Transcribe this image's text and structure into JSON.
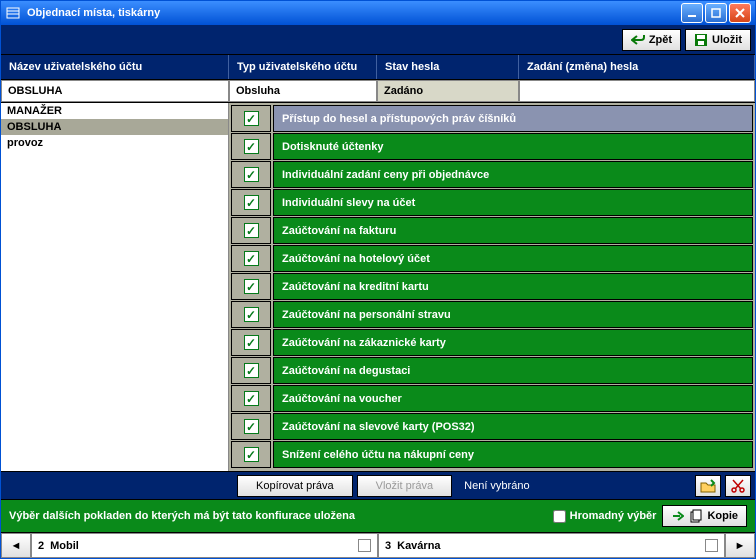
{
  "window": {
    "title": "Objednací místa, tiskárny"
  },
  "toolbar": {
    "back": "Zpět",
    "save": "Uložit"
  },
  "headers": {
    "name": "Název uživatelského účtu",
    "type": "Typ uživatelského účtu",
    "pwstatus": "Stav hesla",
    "pwset": "Zadání (změna) hesla"
  },
  "current": {
    "name": "OBSLUHA",
    "type": "Obsluha",
    "pwstatus": "Zadáno",
    "pwset": ""
  },
  "users": [
    {
      "name": "MANAŽER",
      "sel": false
    },
    {
      "name": "OBSLUHA",
      "sel": true
    },
    {
      "name": "provoz",
      "sel": false
    }
  ],
  "rights": [
    {
      "label": "Přístup do hesel a přístupových práv číšníků",
      "checked": true,
      "sel": true
    },
    {
      "label": "Dotisknuté účtenky",
      "checked": true,
      "sel": false
    },
    {
      "label": "Individuální zadání ceny  při objednávce",
      "checked": true,
      "sel": false
    },
    {
      "label": "Individuální slevy na účet",
      "checked": true,
      "sel": false
    },
    {
      "label": "Zaúčtování na fakturu",
      "checked": true,
      "sel": false
    },
    {
      "label": "Zaúčtování na hotelový účet",
      "checked": true,
      "sel": false
    },
    {
      "label": "Zaúčtování na kreditní kartu",
      "checked": true,
      "sel": false
    },
    {
      "label": "Zaúčtování na personální stravu",
      "checked": true,
      "sel": false
    },
    {
      "label": "Zaúčtování na zákaznické karty",
      "checked": true,
      "sel": false
    },
    {
      "label": "Zaúčtování na degustaci",
      "checked": true,
      "sel": false
    },
    {
      "label": "Zaúčtování na voucher",
      "checked": true,
      "sel": false
    },
    {
      "label": "Zaúčtování na slevové karty (POS32)",
      "checked": true,
      "sel": false
    },
    {
      "label": "Snížení celého účtu na nákupní ceny",
      "checked": true,
      "sel": false
    }
  ],
  "actions": {
    "copy": "Kopírovat práva",
    "paste": "Vložit práva",
    "status": "Není vybráno"
  },
  "greenbar": {
    "text": "Výběr dalších pokladen do kterých má být tato konfiurace uložena",
    "bulk": "Hromadný výběr",
    "copybtn": "Kopie"
  },
  "cashdesks": [
    {
      "num": "2",
      "name": "Mobil"
    },
    {
      "num": "3",
      "name": "Kavárna"
    }
  ]
}
